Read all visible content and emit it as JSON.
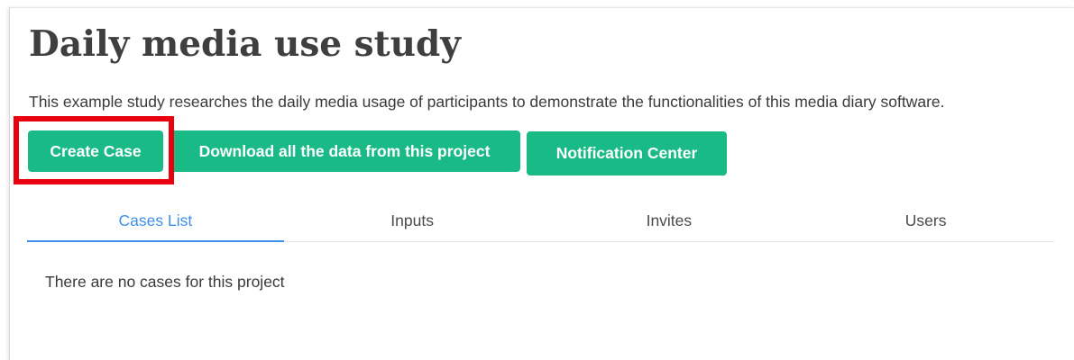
{
  "page": {
    "title": "Daily media use study",
    "description": "This example study researches the daily media usage of participants to demonstrate the functionalities of this media diary software."
  },
  "actions": {
    "create_case": "Create Case",
    "download_all": "Download all the data from this project",
    "notification_center": "Notification Center"
  },
  "tabs": [
    {
      "label": "Cases List",
      "active": true
    },
    {
      "label": "Inputs",
      "active": false
    },
    {
      "label": "Invites",
      "active": false
    },
    {
      "label": "Users",
      "active": false
    }
  ],
  "cases_list": {
    "empty_message": "There are no cases for this project"
  },
  "colors": {
    "button_green": "#1aba86",
    "active_tab_blue": "#3f8ee8",
    "highlight_red": "#e8000e"
  }
}
